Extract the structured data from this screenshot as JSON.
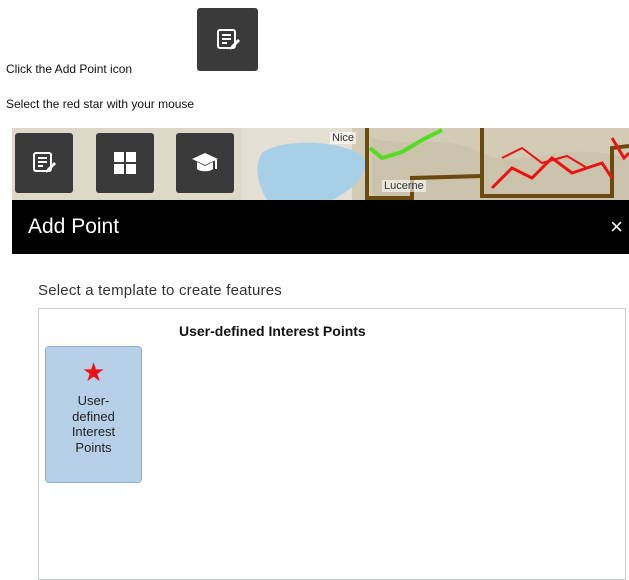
{
  "instructions": {
    "step1": "Click the Add Point icon",
    "step2": "Select the red star with your mouse"
  },
  "icons": {
    "add_point": "edit-list-icon",
    "basemap_gallery": "grid-icon",
    "about": "graduation-cap-icon",
    "close": "close-icon",
    "star": "star-icon"
  },
  "map": {
    "place_labels": [
      "Nice",
      "Lucerne"
    ]
  },
  "panel": {
    "title": "Add Point",
    "close_glyph": "×",
    "prompt": "Select a template to create features",
    "group_title": "User-defined Interest Points",
    "templates": [
      {
        "label": "User-defined Interest Points",
        "star_glyph": "★"
      }
    ]
  },
  "colors": {
    "toolbar_button": "#3a3a3a",
    "panel_header": "#000000",
    "tile_bg": "#b8cfe8",
    "star": "#ee1111",
    "map_route_green": "#55dd22",
    "map_route_red": "#ee1111",
    "map_boundary": "#6b4a10",
    "lake": "#a8cfe8"
  }
}
